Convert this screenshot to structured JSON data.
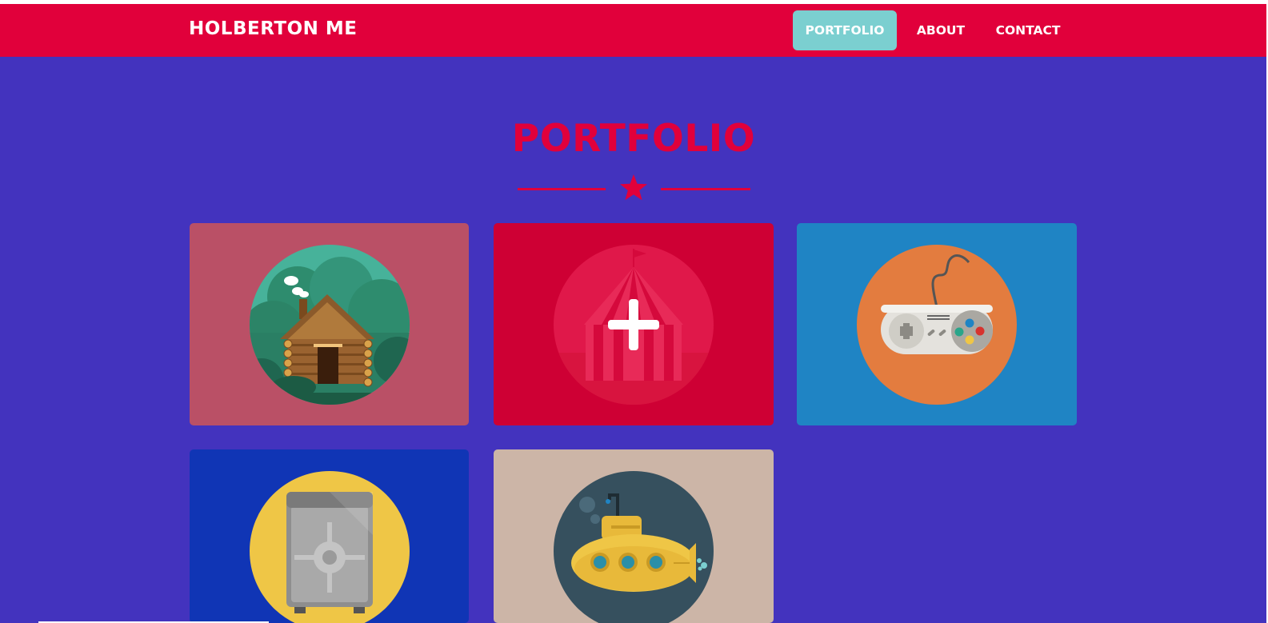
{
  "navbar": {
    "brand": "HOLBERTON ME",
    "items": [
      {
        "label": "PORTFOLIO",
        "active": true
      },
      {
        "label": "ABOUT",
        "active": false
      },
      {
        "label": "CONTACT",
        "active": false
      }
    ]
  },
  "portfolio": {
    "title": "PORTFOLIO",
    "cards": [
      {
        "icon": "cabin-icon",
        "background": "#BA5066",
        "circle": "#2E8C6E"
      },
      {
        "icon": "circus-tent-icon",
        "background": "#CE0034",
        "circle": "#E0184A",
        "hover_icon": "plus-icon"
      },
      {
        "icon": "game-controller-icon",
        "background": "#1F84C4",
        "circle": "#E37C3F"
      },
      {
        "icon": "safe-icon",
        "background": "#1035B5",
        "circle": "#EFC646"
      },
      {
        "icon": "submarine-icon",
        "background": "#CCB5A7",
        "circle": "#36505E"
      }
    ]
  },
  "colors": {
    "page_background": "#4333BE",
    "navbar": "#E1003B",
    "accent": "#E1003B",
    "active_tab": "#7BCFD0"
  }
}
